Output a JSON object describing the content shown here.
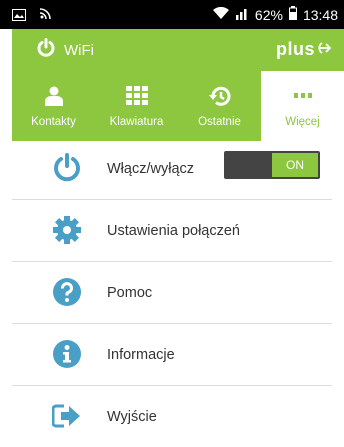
{
  "status_bar": {
    "battery_percent": "62%",
    "time": "13:48"
  },
  "header": {
    "wifi_label": "WiFi",
    "brand": "plus"
  },
  "tabs": [
    {
      "label": "Kontakty",
      "icon": "contacts-icon"
    },
    {
      "label": "Klawiatura",
      "icon": "dialpad-icon"
    },
    {
      "label": "Ostatnie",
      "icon": "history-icon"
    },
    {
      "label": "Więcej",
      "icon": "more-icon",
      "active": true
    }
  ],
  "menu": {
    "items": [
      {
        "label": "Włącz/wyłącz",
        "icon": "power-icon"
      },
      {
        "label": "Ustawienia połączeń",
        "icon": "gear-icon"
      },
      {
        "label": "Pomoc",
        "icon": "help-icon"
      },
      {
        "label": "Informacje",
        "icon": "info-icon"
      },
      {
        "label": "Wyjście",
        "icon": "exit-icon"
      }
    ],
    "toggle_label": "ON"
  },
  "colors": {
    "brand_green": "#8dc63f",
    "icon_blue": "#4a9fc6",
    "status_bar": "#000000"
  }
}
